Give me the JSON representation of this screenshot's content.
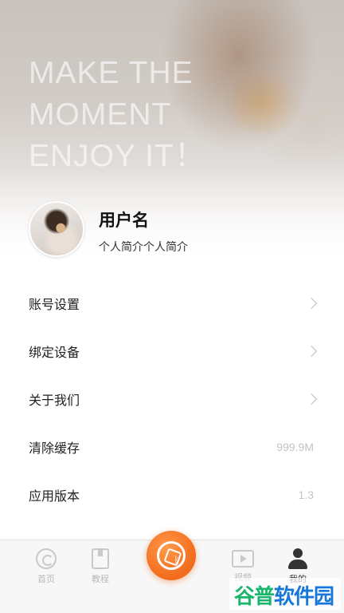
{
  "hero": {
    "slogan": [
      "MAKE THE",
      "MOMENT",
      "ENJOY IT！"
    ]
  },
  "profile": {
    "username": "用户名",
    "bio": "个人简介个人简介"
  },
  "menu": [
    {
      "label": "账号设置",
      "value": "",
      "chevron": true
    },
    {
      "label": "绑定设备",
      "value": "",
      "chevron": true
    },
    {
      "label": "关于我们",
      "value": "",
      "chevron": true
    },
    {
      "label": "清除缓存",
      "value": "999.9M",
      "chevron": false
    },
    {
      "label": "应用版本",
      "value": "1.3",
      "chevron": false
    }
  ],
  "tabbar": {
    "tabs": [
      {
        "label": "首页",
        "icon": "home-icon",
        "active": false
      },
      {
        "label": "教程",
        "icon": "book-icon",
        "active": false
      },
      {
        "label": "视频",
        "icon": "video-icon",
        "active": false
      },
      {
        "label": "我的",
        "icon": "user-icon",
        "active": true
      }
    ],
    "center_icon": "camera-shutter-bluetooth-icon",
    "accent_color": "#f26a1b"
  },
  "watermark": {
    "part1": "谷普",
    "part2": "软件园"
  }
}
